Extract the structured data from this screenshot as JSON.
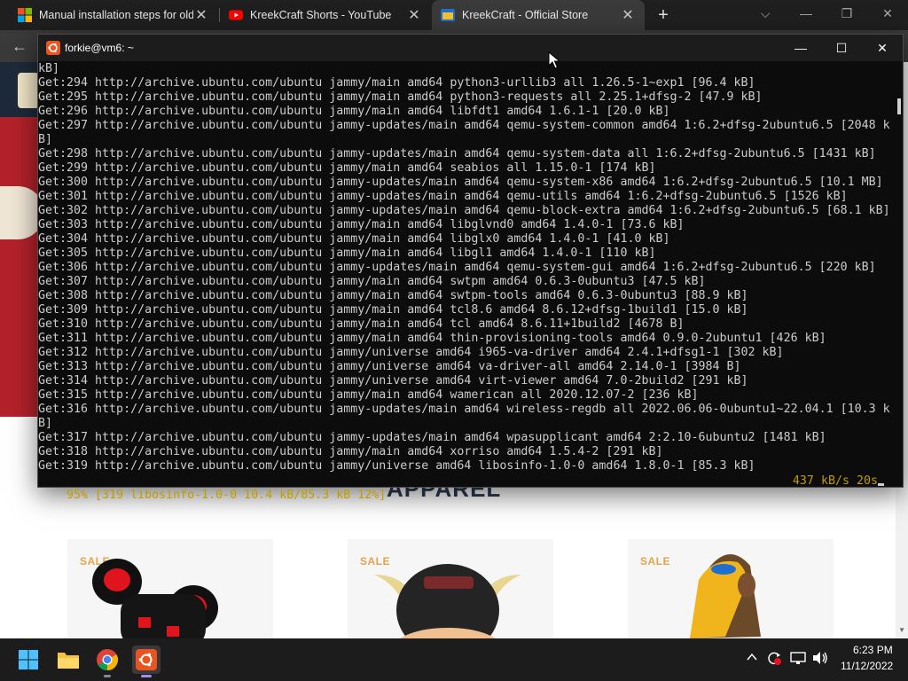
{
  "browser": {
    "tabs": [
      {
        "label": "Manual installation steps for olde",
        "favicon": "microsoft-icon"
      },
      {
        "label": "KreekCraft Shorts - YouTube",
        "favicon": "youtube-icon"
      },
      {
        "label": "KreekCraft - Official Store",
        "favicon": "store-icon"
      }
    ],
    "active_tab": 2,
    "new_tab_symbol": "+"
  },
  "page": {
    "section_heading": "APPAREL",
    "sale_badge": "SALE",
    "colors": {
      "hero": "#b3222a",
      "heading": "#2c3a4e",
      "sale": "#e2a64a"
    }
  },
  "terminal": {
    "title": "forkie@vm6: ~",
    "lines": [
      "kB]",
      "Get:294 http://archive.ubuntu.com/ubuntu jammy/main amd64 python3-urllib3 all 1.26.5-1~exp1 [96.4 kB]",
      "Get:295 http://archive.ubuntu.com/ubuntu jammy/main amd64 python3-requests all 2.25.1+dfsg-2 [47.9 kB]",
      "Get:296 http://archive.ubuntu.com/ubuntu jammy/main amd64 libfdt1 amd64 1.6.1-1 [20.0 kB]",
      "Get:297 http://archive.ubuntu.com/ubuntu jammy-updates/main amd64 qemu-system-common amd64 1:6.2+dfsg-2ubuntu6.5 [2048 k",
      "B]",
      "Get:298 http://archive.ubuntu.com/ubuntu jammy-updates/main amd64 qemu-system-data all 1:6.2+dfsg-2ubuntu6.5 [1431 kB]",
      "Get:299 http://archive.ubuntu.com/ubuntu jammy/main amd64 seabios all 1.15.0-1 [174 kB]",
      "Get:300 http://archive.ubuntu.com/ubuntu jammy-updates/main amd64 qemu-system-x86 amd64 1:6.2+dfsg-2ubuntu6.5 [10.1 MB]",
      "Get:301 http://archive.ubuntu.com/ubuntu jammy-updates/main amd64 qemu-utils amd64 1:6.2+dfsg-2ubuntu6.5 [1526 kB]",
      "Get:302 http://archive.ubuntu.com/ubuntu jammy-updates/main amd64 qemu-block-extra amd64 1:6.2+dfsg-2ubuntu6.5 [68.1 kB]",
      "Get:303 http://archive.ubuntu.com/ubuntu jammy/main amd64 libglvnd0 amd64 1.4.0-1 [73.6 kB]",
      "Get:304 http://archive.ubuntu.com/ubuntu jammy/main amd64 libglx0 amd64 1.4.0-1 [41.0 kB]",
      "Get:305 http://archive.ubuntu.com/ubuntu jammy/main amd64 libgl1 amd64 1.4.0-1 [110 kB]",
      "Get:306 http://archive.ubuntu.com/ubuntu jammy-updates/main amd64 qemu-system-gui amd64 1:6.2+dfsg-2ubuntu6.5 [220 kB]",
      "Get:307 http://archive.ubuntu.com/ubuntu jammy/main amd64 swtpm amd64 0.6.3-0ubuntu3 [47.5 kB]",
      "Get:308 http://archive.ubuntu.com/ubuntu jammy/main amd64 swtpm-tools amd64 0.6.3-0ubuntu3 [88.9 kB]",
      "Get:309 http://archive.ubuntu.com/ubuntu jammy/main amd64 tcl8.6 amd64 8.6.12+dfsg-1build1 [15.0 kB]",
      "Get:310 http://archive.ubuntu.com/ubuntu jammy/main amd64 tcl amd64 8.6.11+1build2 [4678 B]",
      "Get:311 http://archive.ubuntu.com/ubuntu jammy/main amd64 thin-provisioning-tools amd64 0.9.0-2ubuntu1 [426 kB]",
      "Get:312 http://archive.ubuntu.com/ubuntu jammy/universe amd64 i965-va-driver amd64 2.4.1+dfsg1-1 [302 kB]",
      "Get:313 http://archive.ubuntu.com/ubuntu jammy/universe amd64 va-driver-all amd64 2.14.0-1 [3984 B]",
      "Get:314 http://archive.ubuntu.com/ubuntu jammy/universe amd64 virt-viewer amd64 7.0-2build2 [291 kB]",
      "Get:315 http://archive.ubuntu.com/ubuntu jammy/main amd64 wamerican all 2020.12.07-2 [236 kB]",
      "Get:316 http://archive.ubuntu.com/ubuntu jammy-updates/main amd64 wireless-regdb all 2022.06.06-0ubuntu1~22.04.1 [10.3 k",
      "B]",
      "Get:317 http://archive.ubuntu.com/ubuntu jammy-updates/main amd64 wpasupplicant amd64 2:2.10-6ubuntu2 [1481 kB]",
      "Get:318 http://archive.ubuntu.com/ubuntu jammy/main amd64 xorriso amd64 1.5.4-2 [291 kB]",
      "Get:319 http://archive.ubuntu.com/ubuntu jammy/universe amd64 libosinfo-1.0-0 amd64 1.8.0-1 [85.3 kB]"
    ],
    "status_left": "95% [319 libosinfo-1.0-0 10.4 kB/85.3 kB 12%]",
    "status_right": "437 kB/s 20s",
    "colors": {
      "background": "#0c0c0c",
      "text": "#cccccc",
      "status": "#c19c00"
    }
  },
  "taskbar": {
    "apps": [
      "start-icon",
      "file-explorer-icon",
      "chrome-icon",
      "ubuntu-terminal-icon"
    ],
    "clock_time": "6:23 PM",
    "clock_date": "11/12/2022"
  }
}
